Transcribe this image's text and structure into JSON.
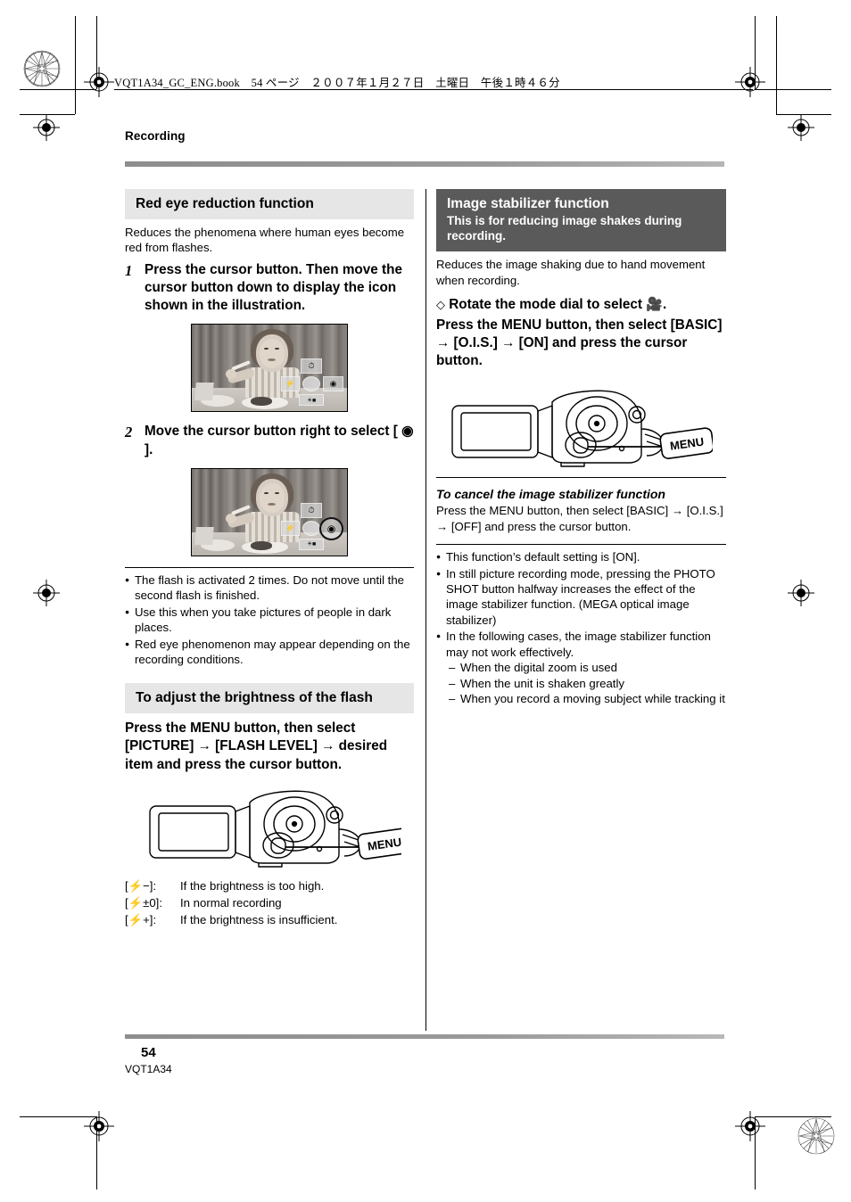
{
  "running_header": "VQT1A34_GC_ENG.book　54 ページ　２００７年１月２７日　土曜日　午後１時４６分",
  "section_label": "Recording",
  "left_column": {
    "heading_redeye": "Red eye reduction function",
    "intro": "Reduces the phenomena where human eyes become red from flashes.",
    "steps": [
      {
        "num": "1",
        "text": "Press the cursor button. Then move the cursor button down to display the icon shown in the illustration."
      },
      {
        "num": "2",
        "text_before": "Move the cursor button right to select [",
        "icon": "red-eye-icon",
        "text_after": "]."
      }
    ],
    "photo_osd": {
      "top": "self-timer-icon",
      "left": "flash-icon",
      "center": "cursor-center-icon",
      "right": "red-eye-icon",
      "bottom": "backlight-icon"
    },
    "bullets": [
      "The flash is activated 2 times. Do not move until the second flash is finished.",
      "Use this when you take pictures of people in dark places.",
      "Red eye phenomenon may appear depending on the recording conditions."
    ],
    "heading_brightness": "To adjust the brightness of the flash",
    "instruction_brightness": "Press the MENU button, then select [PICTURE] → [FLASH LEVEL] → desired item and press the cursor button.",
    "diagram_callout": "MENU",
    "flash_levels": [
      {
        "key": "[⚡−]:",
        "value": "If the brightness is too high."
      },
      {
        "key": "[⚡±0]:",
        "value": "In normal recording"
      },
      {
        "key": "[⚡+]:",
        "value": "If the brightness is insufficient."
      }
    ]
  },
  "right_column": {
    "heading_title": "Image stabilizer function",
    "heading_subtitle": "This is for reducing image shakes during recording.",
    "intro": "Reduces the image shaking due to hand movement when recording.",
    "diamond_line_before": "Rotate the mode dial to select",
    "diamond_mode_icon": "movie-camera-icon",
    "diamond_line_after": ".",
    "instruction": "Press the MENU button, then select [BASIC] → [O.I.S.] → [ON] and press the cursor button.",
    "diagram_callout": "MENU",
    "cancel_heading": "To cancel the image stabilizer function",
    "cancel_text": "Press the MENU button, then select [BASIC] → [O.I.S.] → [OFF] and press the cursor button.",
    "bullets": [
      "This function’s default setting is [ON].",
      "In still picture recording mode, pressing the PHOTO SHOT button halfway increases the effect of the image stabilizer function. (MEGA optical image stabilizer)",
      "In the following cases, the image stabilizer function may not work effectively."
    ],
    "sub_items": [
      "When the digital zoom is used",
      "When the unit is shaken greatly",
      "When you record a moving subject while tracking it"
    ]
  },
  "footer": {
    "page_number": "54",
    "page_code": "VQT1A34"
  },
  "colors": {
    "heading_gray_bg": "#e6e6e6",
    "heading_dark_bg": "#5a5a5a",
    "rule_gray": "#8d8d8d"
  }
}
